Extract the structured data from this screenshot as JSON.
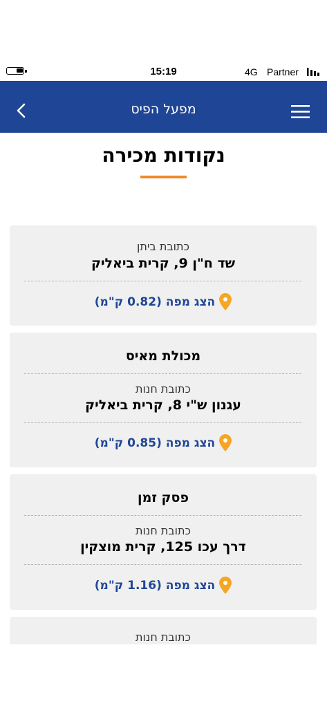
{
  "status_bar": {
    "time": "15:19",
    "network": "4G",
    "carrier": "Partner",
    "battery_icon": "battery-icon",
    "signal_icon": "signal-bars-icon"
  },
  "header": {
    "title": "מפעל הפיס",
    "background_color": "#1f4696",
    "back_icon": "chevron-left-icon",
    "menu_icon": "hamburger-menu-icon"
  },
  "page": {
    "title": "נקודות מכירה",
    "accent_color": "#ee8a2b"
  },
  "points": [
    {
      "label": "כתובת ביתן",
      "address": "שד ח\"ן 9, קרית ביאליק",
      "map_link": "הצג מפה (0.82 ק\"מ)"
    },
    {
      "name": "מכולת מאיס",
      "label": "כתובת חנות",
      "address": "עגנון ש\"י 8, קרית ביאליק",
      "map_link": "הצג מפה (0.85 ק\"מ)"
    },
    {
      "name": "פסק זמן",
      "label": "כתובת חנות",
      "address": "דרך עכו 125, קרית מוצקין",
      "map_link": "הצג מפה (1.16 ק\"מ)"
    },
    {
      "label": "כתובת חנות"
    }
  ],
  "map_pin_color": "#f5a623",
  "link_color": "#1f4696"
}
